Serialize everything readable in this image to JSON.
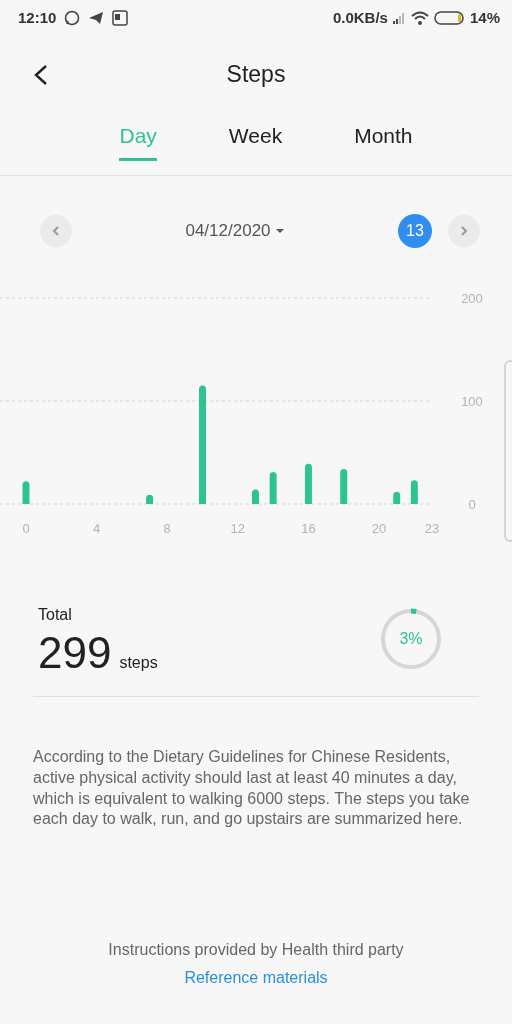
{
  "status_bar": {
    "time": "12:10",
    "speed": "0.0KB/s",
    "battery": "14%"
  },
  "header": {
    "title": "Steps"
  },
  "tabs": [
    {
      "label": "Day",
      "selected": true
    },
    {
      "label": "Week",
      "selected": false
    },
    {
      "label": "Month",
      "selected": false
    }
  ],
  "date_nav": {
    "date": "04/12/2020",
    "day_badge": "13"
  },
  "chart_data": {
    "type": "bar",
    "x": [
      0,
      7,
      10,
      13,
      14,
      16,
      18,
      21,
      22
    ],
    "values": [
      22,
      9,
      115,
      14,
      31,
      39,
      34,
      12,
      23
    ],
    "xlim": [
      0,
      23
    ],
    "ylim": [
      0,
      200
    ],
    "yticks": [
      0,
      100,
      200
    ],
    "xticks": [
      0,
      4,
      8,
      12,
      16,
      20,
      23
    ]
  },
  "total": {
    "label": "Total",
    "value": "299",
    "unit": "steps",
    "percent": "3%"
  },
  "description": "According to the Dietary Guidelines for Chinese Residents, active physical activity should last at least 40 minutes a day, which is equivalent to walking 6000 steps. The steps you take each day to walk, run, and go upstairs are summarized here.",
  "footer": {
    "note": "Instructions provided by Health third party",
    "link": "Reference materials"
  }
}
